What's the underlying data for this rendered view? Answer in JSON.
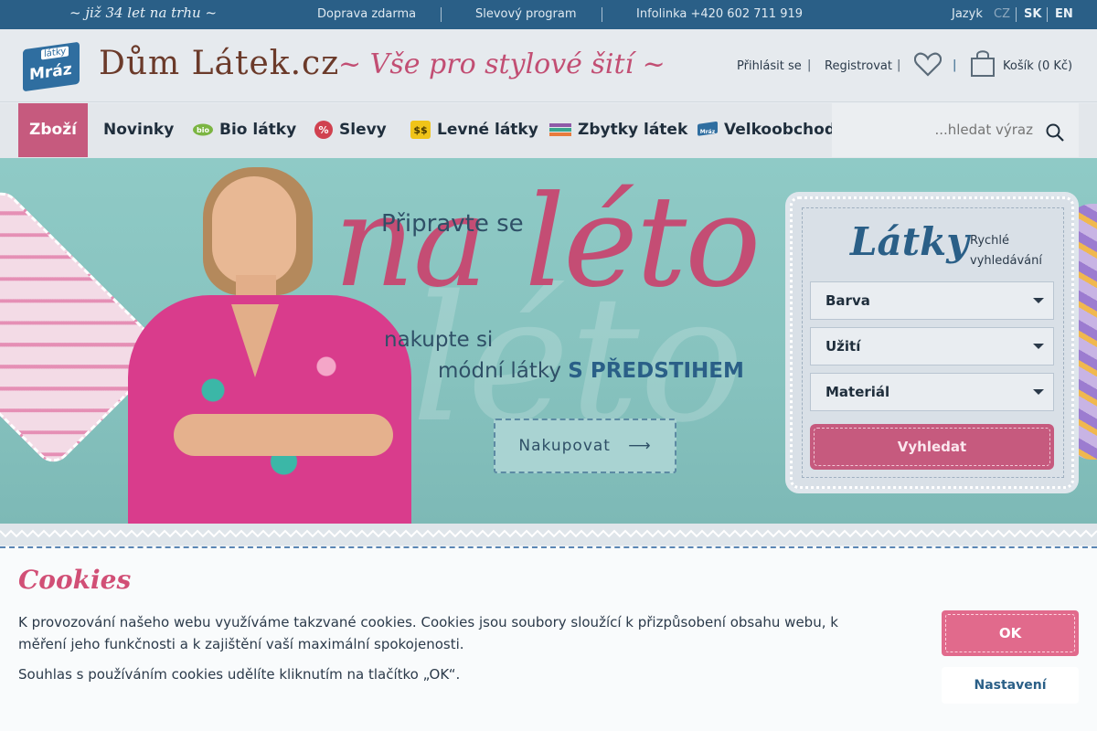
{
  "topbar": {
    "slogan": "~ již 34 let na trhu ~",
    "links": [
      "Doprava zdarma",
      "Slevový program",
      "Infolinka +420 602 711 919"
    ],
    "language_label": "Jazyk",
    "languages": [
      "CZ",
      "SK",
      "EN"
    ],
    "active_language": "CZ"
  },
  "header": {
    "logo_badge_small": "látky",
    "logo_badge_big": "Mráz",
    "logo_text": "Dům Látek.cz",
    "tagline": "~ Vše pro stylové šití ~",
    "login": "Přihlásit se",
    "register": "Registrovat",
    "separator": "|",
    "cart": "Košík (0 Kč)"
  },
  "nav": {
    "items": [
      {
        "label": "Zboží",
        "icon": "none",
        "active": true
      },
      {
        "label": "Novinky",
        "icon": "none"
      },
      {
        "label": "Bio látky",
        "icon": "bio-leaf-icon"
      },
      {
        "label": "Slevy",
        "icon": "percent-icon"
      },
      {
        "label": "Levné látky",
        "icon": "dollar-icon"
      },
      {
        "label": "Zbytky látek",
        "icon": "fabric-stack-icon"
      },
      {
        "label": "Velkoobchod",
        "icon": "mraz-logo-icon"
      }
    ],
    "search_placeholder": "...hledat výraz",
    "bio_badge": "bio",
    "percent_glyph": "%",
    "dollar_glyph": "$$",
    "mraz_glyph": "Mráz"
  },
  "hero": {
    "line1": "Připravte se",
    "big": "na léto",
    "line2": "nakupte si",
    "line3_prefix": "módní látky ",
    "line3_strong": "S PŘEDSTIHEM",
    "button": "Nakupovat",
    "button_arrow": "⟶",
    "ghost": "léto"
  },
  "quick_search": {
    "title": "Látky",
    "subtitle": "Rychlé vyhledávání",
    "selects": [
      "Barva",
      "Užití",
      "Materiál"
    ],
    "button": "Vyhledat"
  },
  "cookie": {
    "title": "Cookies",
    "text1": "K provozování našeho webu využíváme takzvané cookies. Cookies jsou soubory sloužící k přizpůsobení obsahu webu, k měření jeho funkčnosti a k zajištění vaší maximální spokojenosti.",
    "text2": "Souhlas s používáním cookies udělíte kliknutím na tlačítko „OK“.",
    "ok": "OK",
    "settings": "Nastavení"
  },
  "colors": {
    "topbar": "#2a5f87",
    "accent_pink": "#c65a7e",
    "brand_blue": "#2a5f87",
    "hero_bg": "#8fcac6"
  }
}
